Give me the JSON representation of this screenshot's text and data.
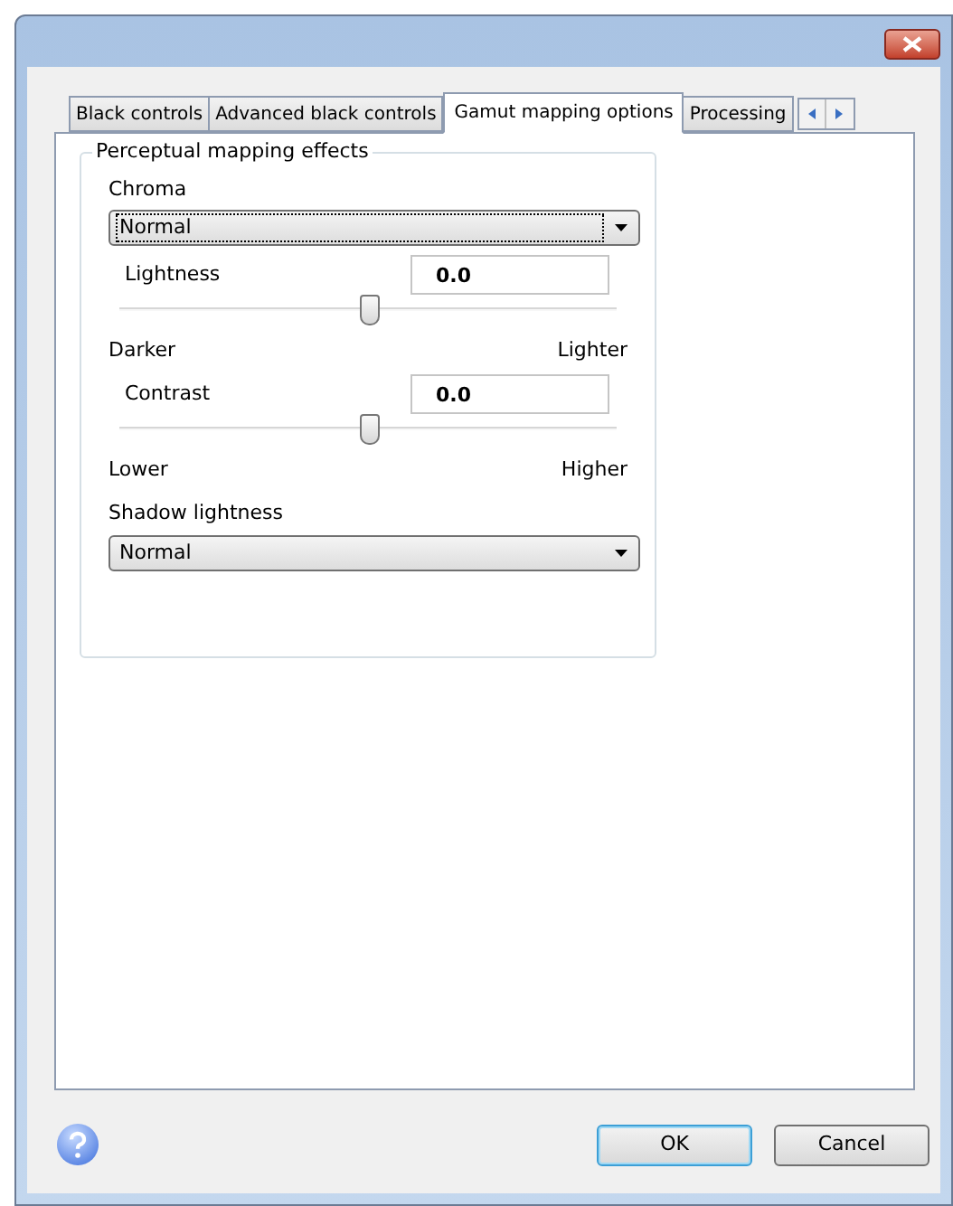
{
  "tabs": [
    {
      "label": "Black controls",
      "selected": false
    },
    {
      "label": "Advanced black controls",
      "selected": false
    },
    {
      "label": "Gamut mapping options",
      "selected": true
    },
    {
      "label": "Processing",
      "selected": false
    }
  ],
  "group": {
    "title": "Perceptual mapping effects",
    "chroma": {
      "label": "Chroma",
      "value": "Normal",
      "focused": true
    },
    "sliders": [
      {
        "label": "Lightness",
        "value": "0.0",
        "level": 0.5,
        "min_label": "Darker",
        "max_label": "Lighter"
      },
      {
        "label": "Contrast",
        "value": "0.0",
        "level": 0.5,
        "min_label": "Lower",
        "max_label": "Higher"
      }
    ],
    "shadow": {
      "label": "Shadow lightness",
      "value": "Normal",
      "focused": false
    }
  },
  "buttons": [
    {
      "label": "OK",
      "default": true
    },
    {
      "label": "Cancel",
      "default": false
    }
  ]
}
